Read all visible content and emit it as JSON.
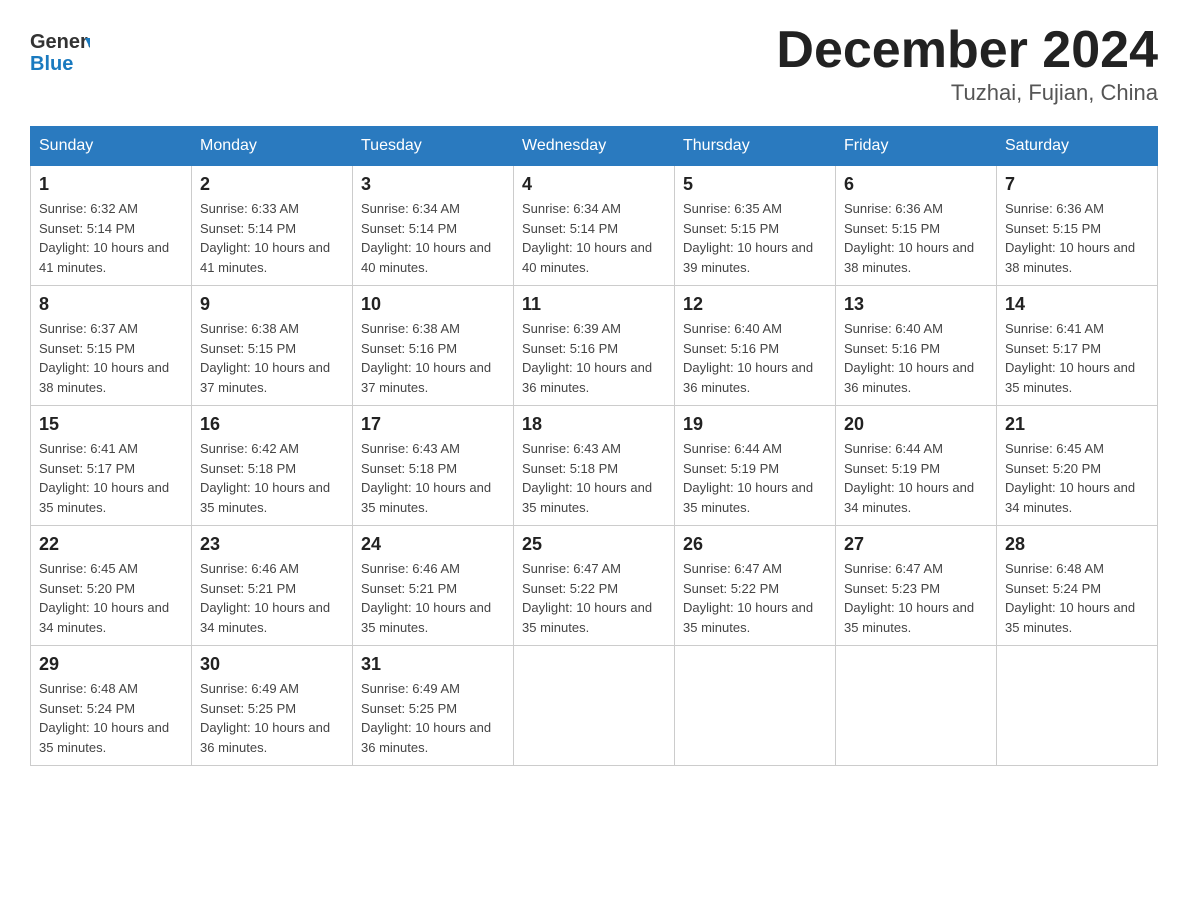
{
  "header": {
    "logo": {
      "general": "General",
      "blue": "Blue",
      "arrow": "▶"
    },
    "title": "December 2024",
    "location": "Tuzhai, Fujian, China"
  },
  "calendar": {
    "days_of_week": [
      "Sunday",
      "Monday",
      "Tuesday",
      "Wednesday",
      "Thursday",
      "Friday",
      "Saturday"
    ],
    "weeks": [
      [
        {
          "day": "1",
          "sunrise": "6:32 AM",
          "sunset": "5:14 PM",
          "daylight": "10 hours and 41 minutes."
        },
        {
          "day": "2",
          "sunrise": "6:33 AM",
          "sunset": "5:14 PM",
          "daylight": "10 hours and 41 minutes."
        },
        {
          "day": "3",
          "sunrise": "6:34 AM",
          "sunset": "5:14 PM",
          "daylight": "10 hours and 40 minutes."
        },
        {
          "day": "4",
          "sunrise": "6:34 AM",
          "sunset": "5:14 PM",
          "daylight": "10 hours and 40 minutes."
        },
        {
          "day": "5",
          "sunrise": "6:35 AM",
          "sunset": "5:15 PM",
          "daylight": "10 hours and 39 minutes."
        },
        {
          "day": "6",
          "sunrise": "6:36 AM",
          "sunset": "5:15 PM",
          "daylight": "10 hours and 38 minutes."
        },
        {
          "day": "7",
          "sunrise": "6:36 AM",
          "sunset": "5:15 PM",
          "daylight": "10 hours and 38 minutes."
        }
      ],
      [
        {
          "day": "8",
          "sunrise": "6:37 AM",
          "sunset": "5:15 PM",
          "daylight": "10 hours and 38 minutes."
        },
        {
          "day": "9",
          "sunrise": "6:38 AM",
          "sunset": "5:15 PM",
          "daylight": "10 hours and 37 minutes."
        },
        {
          "day": "10",
          "sunrise": "6:38 AM",
          "sunset": "5:16 PM",
          "daylight": "10 hours and 37 minutes."
        },
        {
          "day": "11",
          "sunrise": "6:39 AM",
          "sunset": "5:16 PM",
          "daylight": "10 hours and 36 minutes."
        },
        {
          "day": "12",
          "sunrise": "6:40 AM",
          "sunset": "5:16 PM",
          "daylight": "10 hours and 36 minutes."
        },
        {
          "day": "13",
          "sunrise": "6:40 AM",
          "sunset": "5:16 PM",
          "daylight": "10 hours and 36 minutes."
        },
        {
          "day": "14",
          "sunrise": "6:41 AM",
          "sunset": "5:17 PM",
          "daylight": "10 hours and 35 minutes."
        }
      ],
      [
        {
          "day": "15",
          "sunrise": "6:41 AM",
          "sunset": "5:17 PM",
          "daylight": "10 hours and 35 minutes."
        },
        {
          "day": "16",
          "sunrise": "6:42 AM",
          "sunset": "5:18 PM",
          "daylight": "10 hours and 35 minutes."
        },
        {
          "day": "17",
          "sunrise": "6:43 AM",
          "sunset": "5:18 PM",
          "daylight": "10 hours and 35 minutes."
        },
        {
          "day": "18",
          "sunrise": "6:43 AM",
          "sunset": "5:18 PM",
          "daylight": "10 hours and 35 minutes."
        },
        {
          "day": "19",
          "sunrise": "6:44 AM",
          "sunset": "5:19 PM",
          "daylight": "10 hours and 35 minutes."
        },
        {
          "day": "20",
          "sunrise": "6:44 AM",
          "sunset": "5:19 PM",
          "daylight": "10 hours and 34 minutes."
        },
        {
          "day": "21",
          "sunrise": "6:45 AM",
          "sunset": "5:20 PM",
          "daylight": "10 hours and 34 minutes."
        }
      ],
      [
        {
          "day": "22",
          "sunrise": "6:45 AM",
          "sunset": "5:20 PM",
          "daylight": "10 hours and 34 minutes."
        },
        {
          "day": "23",
          "sunrise": "6:46 AM",
          "sunset": "5:21 PM",
          "daylight": "10 hours and 34 minutes."
        },
        {
          "day": "24",
          "sunrise": "6:46 AM",
          "sunset": "5:21 PM",
          "daylight": "10 hours and 35 minutes."
        },
        {
          "day": "25",
          "sunrise": "6:47 AM",
          "sunset": "5:22 PM",
          "daylight": "10 hours and 35 minutes."
        },
        {
          "day": "26",
          "sunrise": "6:47 AM",
          "sunset": "5:22 PM",
          "daylight": "10 hours and 35 minutes."
        },
        {
          "day": "27",
          "sunrise": "6:47 AM",
          "sunset": "5:23 PM",
          "daylight": "10 hours and 35 minutes."
        },
        {
          "day": "28",
          "sunrise": "6:48 AM",
          "sunset": "5:24 PM",
          "daylight": "10 hours and 35 minutes."
        }
      ],
      [
        {
          "day": "29",
          "sunrise": "6:48 AM",
          "sunset": "5:24 PM",
          "daylight": "10 hours and 35 minutes."
        },
        {
          "day": "30",
          "sunrise": "6:49 AM",
          "sunset": "5:25 PM",
          "daylight": "10 hours and 36 minutes."
        },
        {
          "day": "31",
          "sunrise": "6:49 AM",
          "sunset": "5:25 PM",
          "daylight": "10 hours and 36 minutes."
        },
        null,
        null,
        null,
        null
      ]
    ]
  }
}
